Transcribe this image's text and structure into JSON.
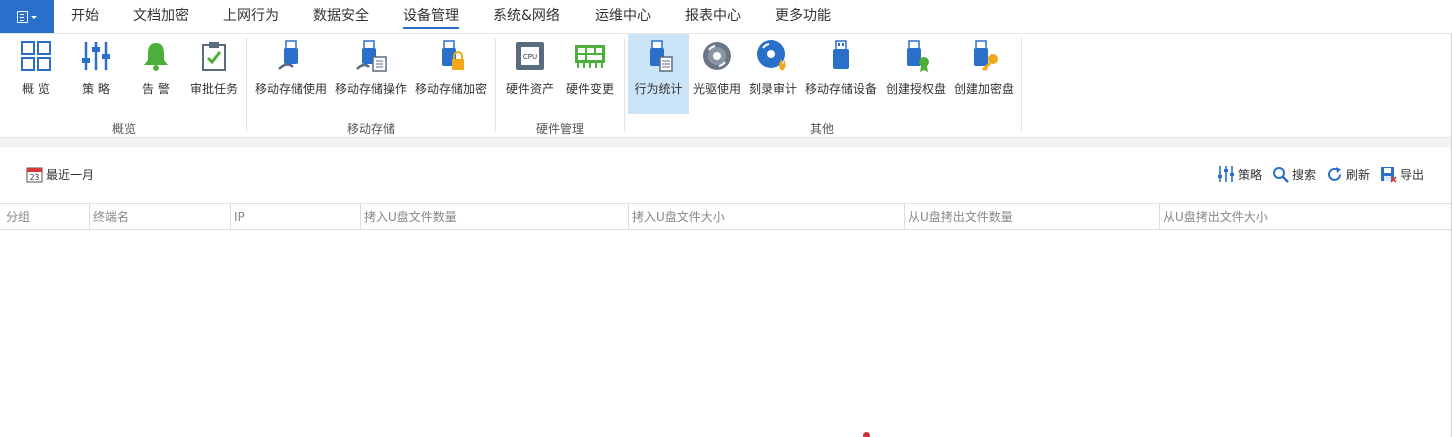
{
  "menu": {
    "app_button_icon": "app-menu-icon",
    "tabs": [
      {
        "label": "开始"
      },
      {
        "label": "文档加密"
      },
      {
        "label": "上网行为"
      },
      {
        "label": "数据安全"
      },
      {
        "label": "设备管理",
        "active": true
      },
      {
        "label": "系统&网络"
      },
      {
        "label": "运维中心"
      },
      {
        "label": "报表中心"
      },
      {
        "label": "更多功能"
      }
    ]
  },
  "ribbon": {
    "groups": [
      {
        "label": "概览",
        "buttons": [
          {
            "label": "概 览",
            "icon": "overview-grid-icon"
          },
          {
            "label": "策 略",
            "icon": "policy-sliders-icon"
          },
          {
            "label": "告 警",
            "icon": "alarm-bell-icon"
          },
          {
            "label": "审批任务",
            "icon": "approval-task-icon"
          }
        ]
      },
      {
        "label": "移动存储",
        "buttons": [
          {
            "label": "移动存储使用",
            "icon": "usb-usage-icon"
          },
          {
            "label": "移动存储操作",
            "icon": "usb-operation-icon"
          },
          {
            "label": "移动存储加密",
            "icon": "usb-encrypt-icon"
          }
        ]
      },
      {
        "label": "硬件管理",
        "buttons": [
          {
            "label": "硬件资产",
            "icon": "cpu-icon"
          },
          {
            "label": "硬件变更",
            "icon": "hardware-board-icon"
          }
        ]
      },
      {
        "label": "其他",
        "buttons": [
          {
            "label": "行为统计",
            "icon": "usb-stats-icon",
            "active": true
          },
          {
            "label": "光驱使用",
            "icon": "optical-disc-icon"
          },
          {
            "label": "刻录审计",
            "icon": "burn-disc-icon"
          },
          {
            "label": "移动存储设备",
            "icon": "usb-device-icon"
          },
          {
            "label": "创建授权盘",
            "icon": "usb-authorize-icon"
          },
          {
            "label": "创建加密盘",
            "icon": "usb-key-icon"
          }
        ]
      }
    ]
  },
  "toolbar": {
    "date_range": "最近一月",
    "date_icon_day": "23",
    "actions": [
      {
        "label": "策略",
        "icon": "policy-sliders-icon"
      },
      {
        "label": "搜索",
        "icon": "search-icon"
      },
      {
        "label": "刷新",
        "icon": "refresh-icon"
      },
      {
        "label": "导出",
        "icon": "export-icon"
      }
    ]
  },
  "table": {
    "columns": [
      "分组",
      "终端名",
      "IP",
      "拷入U盘文件数量",
      "拷入U盘文件大小",
      "从U盘拷出文件数量",
      "从U盘拷出文件大小"
    ],
    "rows": []
  },
  "colors": {
    "accent": "#2a6fc9",
    "active_button_bg": "#cce4f7",
    "bell_green": "#4caf3a",
    "key_gold": "#f0a818"
  }
}
